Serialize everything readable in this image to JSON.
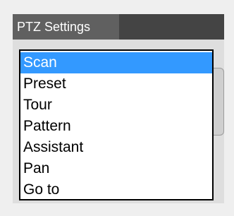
{
  "panel": {
    "title": "PTZ Settings"
  },
  "dropdown": {
    "selected": "Scan",
    "options": [
      "Scan",
      "Preset",
      "Tour",
      "Pattern",
      "Assistant",
      "Pan",
      "Go to"
    ]
  },
  "colors": {
    "header_bg": "#444444",
    "title_tab_bg": "#606060",
    "selected_bg": "#3399ff",
    "selected_text": "#ffffff"
  }
}
